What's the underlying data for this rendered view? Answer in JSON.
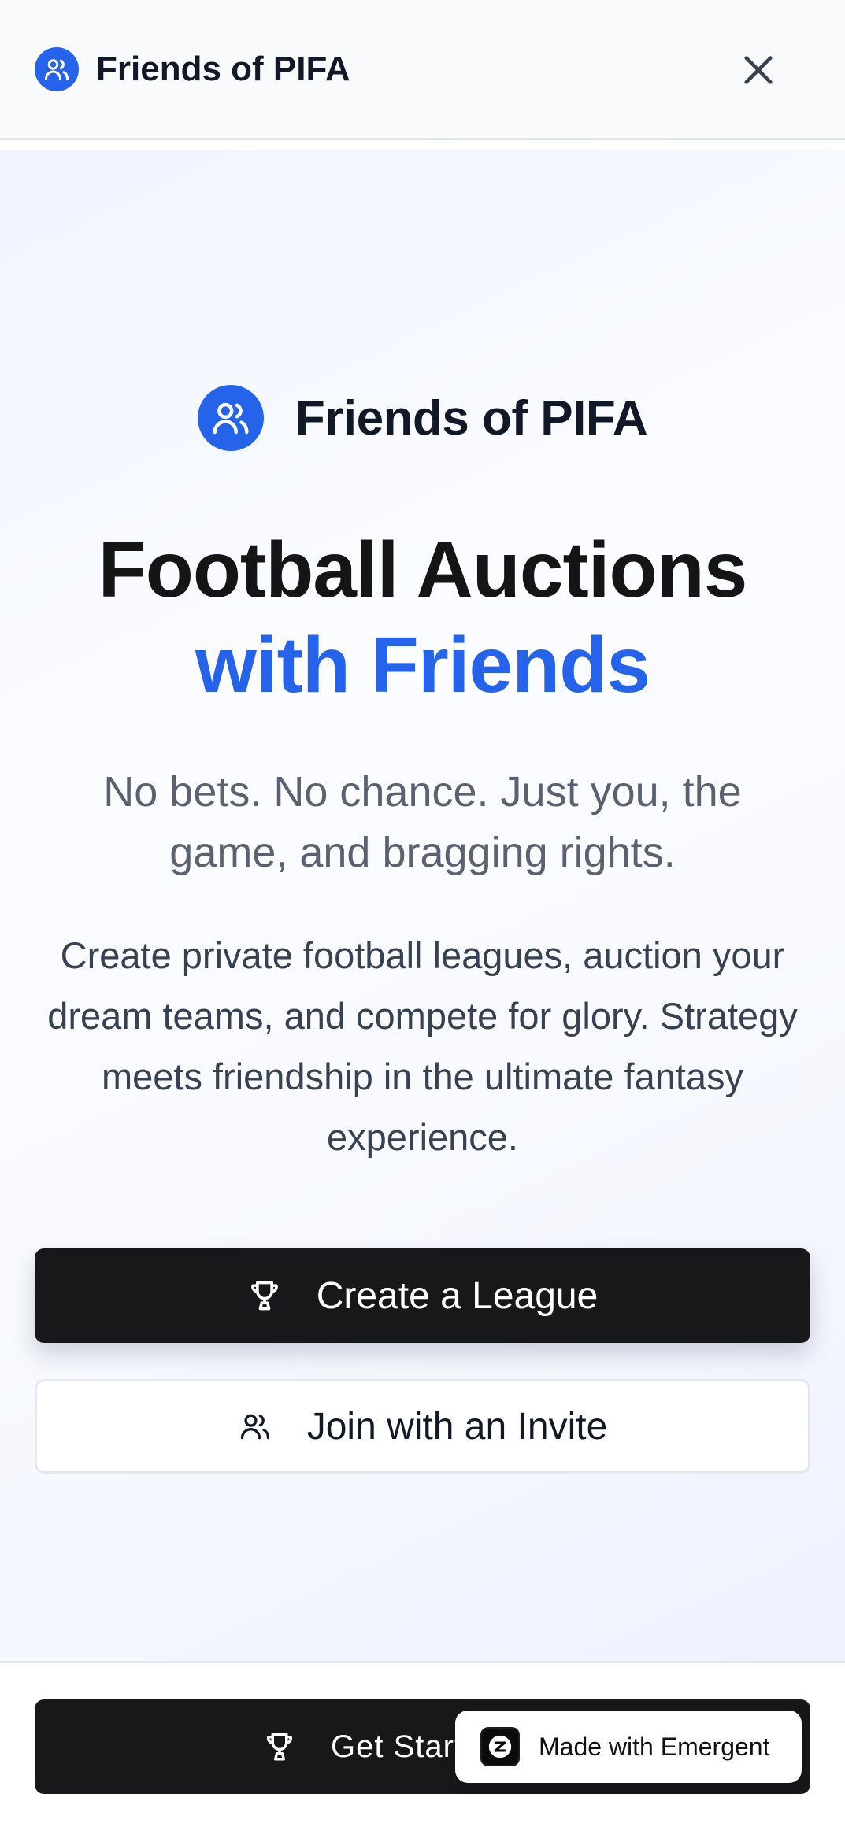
{
  "app": {
    "title": "Friends of PIFA"
  },
  "header": {
    "title": "Friends of PIFA",
    "logo_icon": "users-icon",
    "close_icon": "close-icon"
  },
  "hero": {
    "brand_title": "Friends of PIFA",
    "headline_line1": "Football Auctions",
    "headline_line2": "with Friends",
    "tagline": "No bets. No chance. Just you, the game, and bragging rights.",
    "description": "Create private football leagues, auction your dream teams, and compete for glory. Strategy meets friendship in the ultimate fantasy experience.",
    "create_button": {
      "label": "Create a League",
      "icon": "trophy-icon"
    },
    "join_button": {
      "label": "Join with an Invite",
      "icon": "users-icon"
    }
  },
  "bottom_bar": {
    "cta_label": "Get Started",
    "cta_icon": "trophy-icon"
  },
  "badge": {
    "label": "Made with Emergent"
  },
  "colors": {
    "accent": "#2563eb",
    "button_dark": "#18181b",
    "text_primary": "#111827",
    "text_muted": "#5b6170"
  }
}
